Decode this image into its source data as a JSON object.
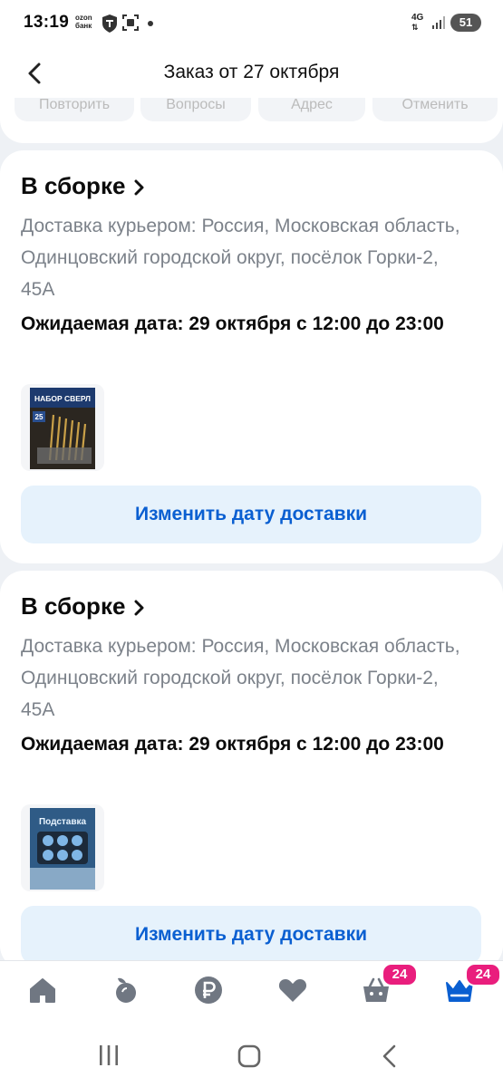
{
  "status_bar": {
    "time": "13:19",
    "ozon_line1": "ozon",
    "ozon_line2": "банк",
    "network": "4G",
    "battery": "51"
  },
  "header": {
    "title": "Заказ от 27 октября",
    "back_icon": "chevron-left-icon"
  },
  "top_card": {
    "chips": [
      "Повторить",
      "Вопросы",
      "Адрес",
      "Отменить"
    ]
  },
  "orders": [
    {
      "status": "В сборке",
      "address": "Доставка курьером: Россия, Московская область, Одинцовский городской округ, посёлок Горки-2, 45А",
      "expected": "Ожидаемая дата: 29 октября с 12:00 до 23:00",
      "thumb_text": "НАБОР СВЕРЛ",
      "thumb_badge": "25",
      "action": "Изменить дату доставки"
    },
    {
      "status": "В сборке",
      "address": "Доставка курьером: Россия, Московская область, Одинцовский городской округ, посёлок Горки-2, 45А",
      "expected": "Ожидаемая дата: 29 октября с 12:00 до 23:00",
      "thumb_text": "Подставка",
      "action": "Изменить дату доставки"
    }
  ],
  "bottom_nav": {
    "items": [
      "home-icon",
      "fresh-icon",
      "ruble-icon",
      "heart-icon",
      "cart-icon",
      "crown-icon"
    ],
    "cart_badge": "24",
    "profile_badge": "24",
    "accent": "#0a5fd1",
    "badge_color": "#e91e7d"
  }
}
